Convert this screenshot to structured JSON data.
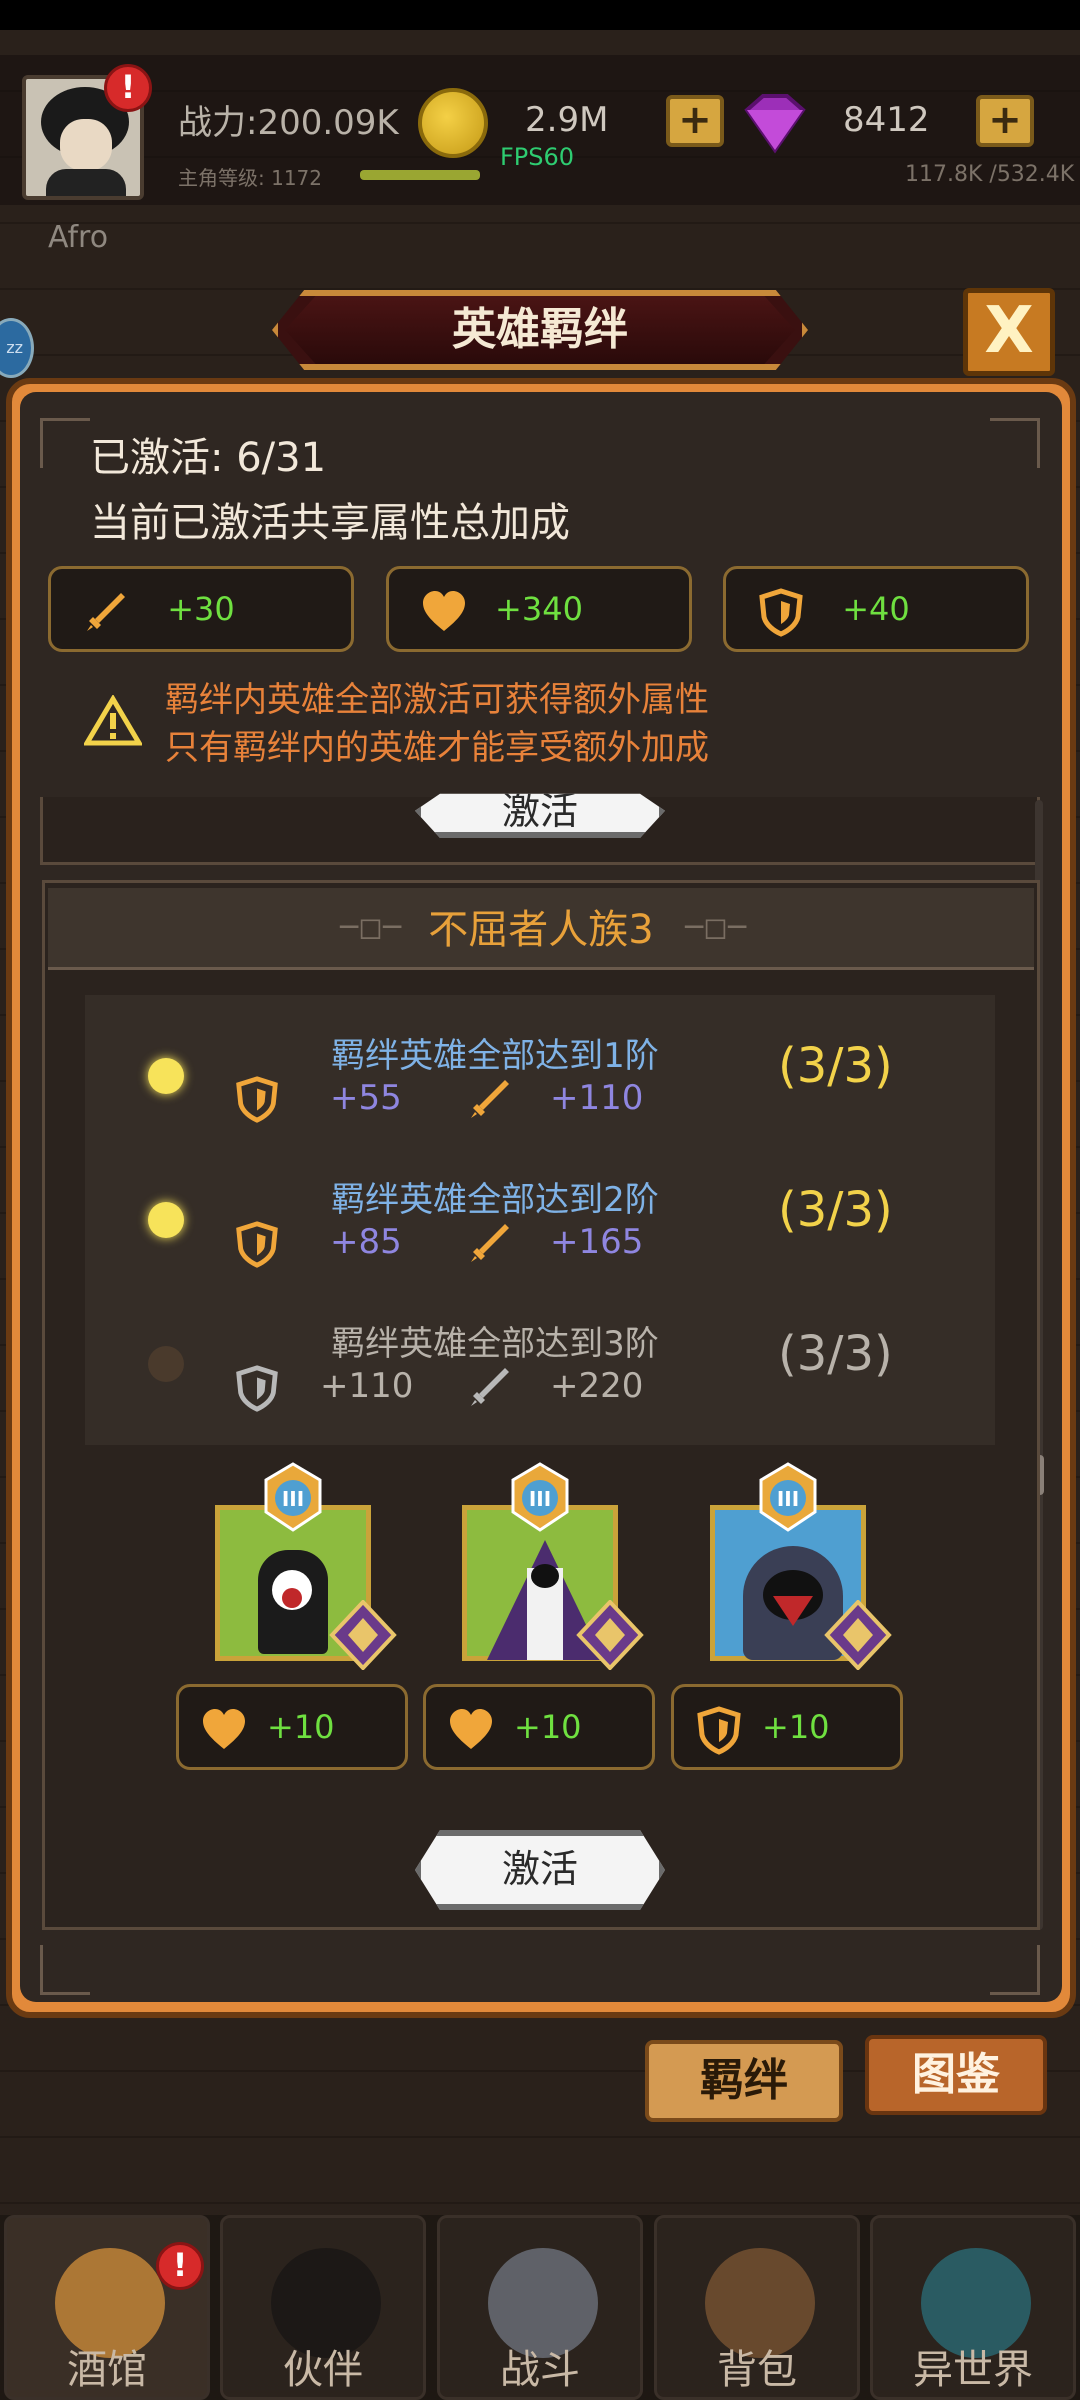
{
  "header": {
    "hero_name": "Afro",
    "power": "战力:200.09K",
    "level_label": "主角等级: 1172",
    "fps": "FPS60",
    "gold": "2.9M",
    "gems": "8412",
    "exp": "117.8K /532.4K",
    "alert_mark": "!",
    "plus_mark": "+",
    "sleep_mark": "zz"
  },
  "dialog": {
    "title": "英雄羁绊",
    "close_label": "X",
    "activated": "已激活: 6/31",
    "shared_title": "当前已激活共享属性总加成",
    "totals": [
      {
        "icon": "sword-icon",
        "value": "+30"
      },
      {
        "icon": "heart-icon",
        "value": "+340"
      },
      {
        "icon": "shield-icon",
        "value": "+40"
      }
    ],
    "warning_lines": [
      "羁绊内英雄全部激活可获得额外属性",
      "只有羁绊内的英雄才能享受额外加成"
    ],
    "prev_activate_label": "激活"
  },
  "bond_card": {
    "title": "不屈者人族3",
    "tiers": [
      {
        "title": "羁绊英雄全部达到1阶",
        "shield": "+55",
        "sword": "+110",
        "progress": "(3/3)",
        "active": true
      },
      {
        "title": "羁绊英雄全部达到2阶",
        "shield": "+85",
        "sword": "+165",
        "progress": "(3/3)",
        "active": true
      },
      {
        "title": "羁绊英雄全部达到3阶",
        "shield": "+110",
        "sword": "+220",
        "progress": "(3/3)",
        "active": false
      }
    ],
    "heroes": [
      {
        "rank": "III",
        "bonus_icon": "heart-icon",
        "bonus": "+10",
        "bg": "#8dbb3f"
      },
      {
        "rank": "III",
        "bonus_icon": "heart-icon",
        "bonus": "+10",
        "bg": "#8dbb3f"
      },
      {
        "rank": "III",
        "bonus_icon": "shield-icon",
        "bonus": "+10",
        "bg": "#4f9fd1"
      }
    ],
    "activate_label": "激活"
  },
  "side_tabs": {
    "bond": "羁绊",
    "codex": "图鉴"
  },
  "nav": [
    "酒馆",
    "伙伴",
    "战斗",
    "背包",
    "异世界"
  ],
  "colors": {
    "accent": "#e2893a",
    "gold_text": "#f2d24a",
    "stat_green": "#6fe040",
    "tier_blue": "#7fb2e6",
    "tier_purple": "#8f86e0"
  }
}
